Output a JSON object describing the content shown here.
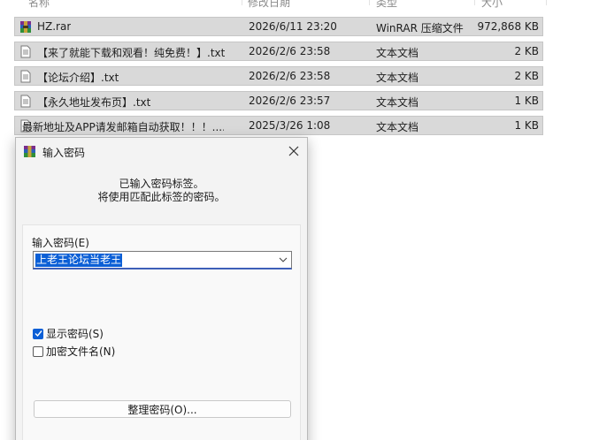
{
  "file_list": {
    "columns": [
      "名称",
      "修改日期",
      "类型",
      "大小"
    ],
    "rows": [
      {
        "name": "HZ.rar",
        "date": "2026/6/11 23:20",
        "type": "WinRAR 压缩文件",
        "size": "972,868 KB",
        "icon": "winrar-archive-icon"
      },
      {
        "name": "【来了就能下载和观看！纯免费！】.txt",
        "date": "2026/2/6 23:58",
        "type": "文本文档",
        "size": "2 KB",
        "icon": "text-file-icon"
      },
      {
        "name": "【论坛介绍】.txt",
        "date": "2026/2/6 23:58",
        "type": "文本文档",
        "size": "2 KB",
        "icon": "text-file-icon"
      },
      {
        "name": "【永久地址发布页】.txt",
        "date": "2026/2/6 23:57",
        "type": "文本文档",
        "size": "1 KB",
        "icon": "text-file-icon"
      },
      {
        "name": "最新地址及APP请发邮箱自动获取！！！....",
        "date": "2025/3/26 1:08",
        "type": "文本文档",
        "size": "1 KB",
        "icon": "text-file-icon"
      }
    ]
  },
  "dialog": {
    "title": "输入密码",
    "info_line1": "已输入密码标签。",
    "info_line2": "将使用匹配此标签的密码。",
    "password_label": "输入密码(E)",
    "password_value": "上老王论坛当老王",
    "show_password": {
      "label": "显示密码(S)",
      "checked": true
    },
    "encrypt_filenames": {
      "label": "加密文件名(N)",
      "checked": false
    },
    "organize_button": "整理密码(O)...",
    "colors": {
      "accent": "#0b5fd6",
      "row_highlight": "#d9d9d9"
    }
  }
}
